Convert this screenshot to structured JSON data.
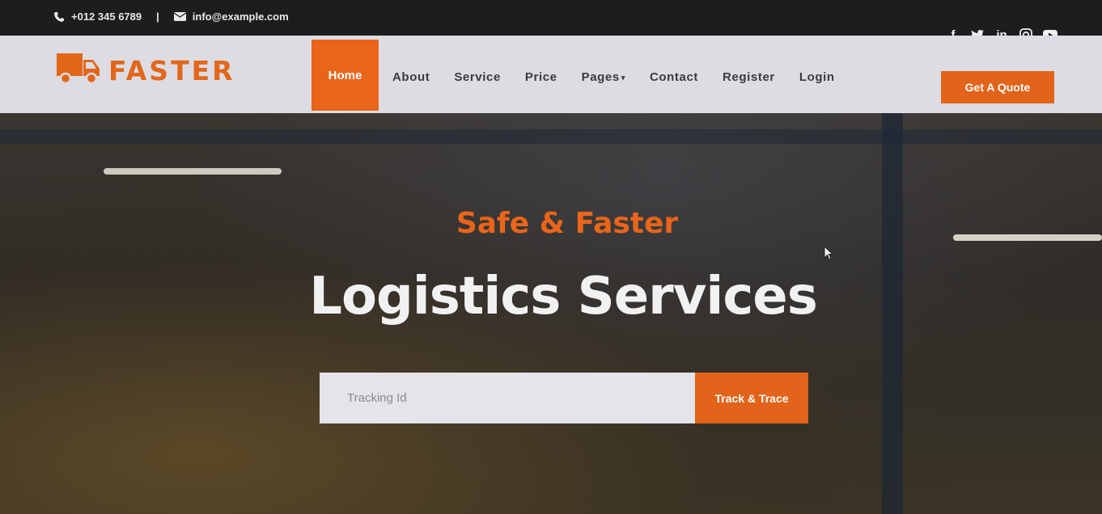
{
  "topbar": {
    "phone": "+012 345 6789",
    "separator": "|",
    "email": "info@example.com",
    "social": [
      {
        "icon": "facebook-icon",
        "glyph": "f"
      },
      {
        "icon": "twitter-icon",
        "glyph": "t"
      },
      {
        "icon": "linkedin-icon",
        "glyph": "in"
      },
      {
        "icon": "instagram-icon",
        "glyph": "◎"
      },
      {
        "icon": "youtube-icon",
        "glyph": "▶"
      }
    ]
  },
  "brand": {
    "name": "FASTER",
    "icon": "truck-icon"
  },
  "nav": {
    "home": "Home",
    "items": [
      "About",
      "Service",
      "Price",
      "Pages",
      "Contact",
      "Register",
      "Login"
    ],
    "quote_button": "Get A Quote"
  },
  "hero": {
    "subtitle": "Safe & Faster",
    "title": "Logistics Services",
    "tracking_placeholder": "Tracking Id",
    "track_button": "Track & Trace"
  },
  "colors": {
    "accent": "#e8651a"
  }
}
